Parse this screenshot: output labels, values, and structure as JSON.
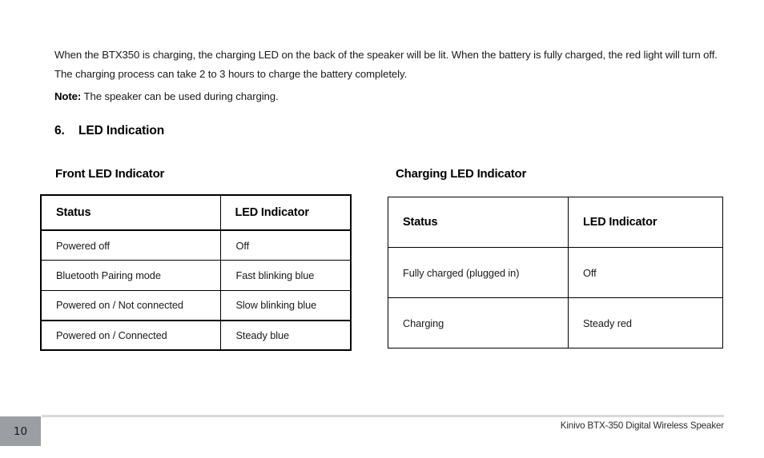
{
  "body": {
    "intro_paragraph": "When the BTX350 is charging, the charging LED on the back of the speaker will be lit. When the battery is fully charged, the red light will turn off. The charging process can take 2 to 3 hours to charge the battery completely.",
    "note_label": "Note:",
    "note_text": " The speaker can be used during charging."
  },
  "section": {
    "number": "6.",
    "title": "LED Indication"
  },
  "front_led": {
    "caption": "Front LED Indicator",
    "headers": [
      "Status",
      "LED Indicator"
    ],
    "rows": [
      {
        "status": "Powered off",
        "led": "Off"
      },
      {
        "status": "Bluetooth Pairing mode",
        "led": "Fast blinking blue"
      },
      {
        "status": "Powered on / Not connected",
        "led": "Slow blinking blue"
      },
      {
        "status": "Powered on / Connected",
        "led": "Steady blue"
      }
    ]
  },
  "charging_led": {
    "caption": "Charging LED Indicator",
    "headers": [
      "Status",
      "LED Indicator"
    ],
    "rows": [
      {
        "status": "Fully charged (plugged in)",
        "led": "Off"
      },
      {
        "status": "Charging",
        "led": "Steady red"
      }
    ]
  },
  "footer": {
    "page_number": "10",
    "document_title": "Kinivo BTX-350 Digital Wireless Speaker",
    "rule_color": "#d9d9d9",
    "page_box_color": "#9b9ea3"
  }
}
